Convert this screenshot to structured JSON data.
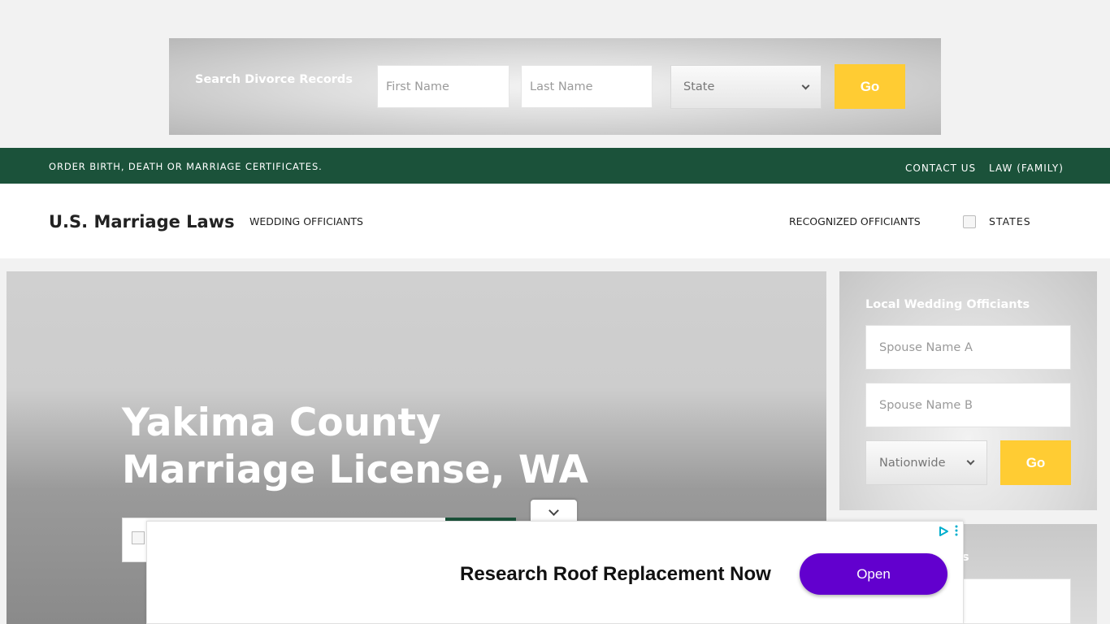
{
  "search_banner": {
    "title": "Search Divorce Records",
    "first_name_placeholder": "First Name",
    "last_name_placeholder": "Last Name",
    "state_value": "State",
    "go_label": "Go"
  },
  "top_bar": {
    "order_text": "ORDER BIRTH, DEATH OR MARRIAGE CERTIFICATES.",
    "links": [
      "CONTACT US",
      "LAW (FAMILY)"
    ]
  },
  "nav": {
    "brand": "U.S. Marriage Laws",
    "wedding_officiants": "WEDDING OFFICIANTS",
    "recognized_officiants": "RECOGNIZED OFFICIANTS",
    "states": "STATES"
  },
  "hero": {
    "title": "Yakima County Marriage License, WA"
  },
  "sidebar": {
    "title": "Local Wedding Officiants",
    "spouse_a_placeholder": "Spouse Name A",
    "spouse_b_placeholder": "Spouse Name B",
    "location_value": "Nationwide",
    "go_label": "Go",
    "second_title_fragment": "ls"
  },
  "ad": {
    "headline": "Research Roof Replacement Now",
    "button_label": "Open"
  },
  "colors": {
    "green": "#1b523a",
    "yellow": "#ffcc33",
    "ad_purple": "#6200ce"
  }
}
